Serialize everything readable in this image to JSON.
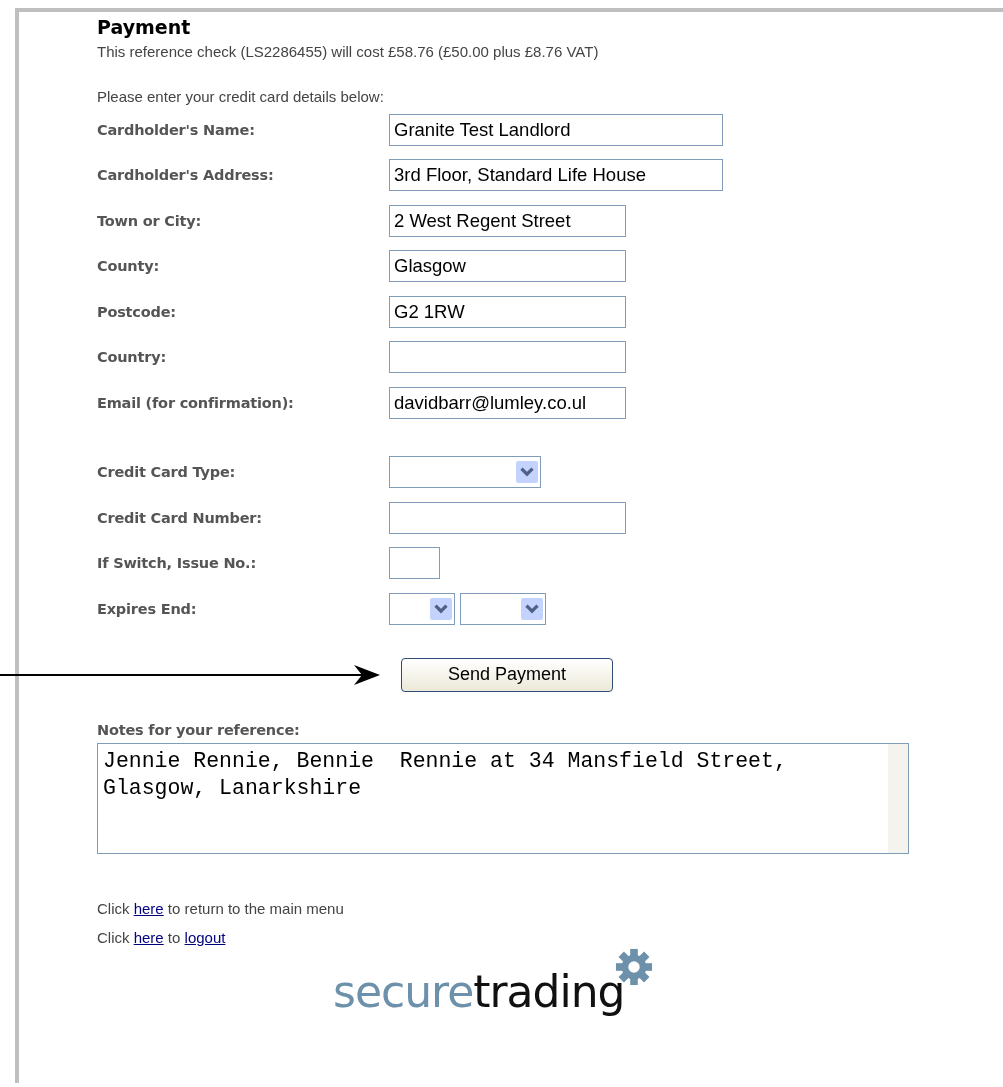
{
  "title": "Payment",
  "summary": "This reference check (LS2286455) will cost £58.76 (£50.00 plus £8.76 VAT)",
  "instruction": "Please enter your credit card details below:",
  "cardholder_fields": [
    {
      "label": "Cardholder's Name:",
      "kind": "text",
      "value": "Granite Test Landlord"
    },
    {
      "label": "Cardholder's Address:",
      "kind": "text",
      "value": "3rd Floor, Standard Life House"
    },
    {
      "label": "Town or City:",
      "kind": "text",
      "value": "2 West Regent Street"
    },
    {
      "label": "County:",
      "kind": "text",
      "value": "Glasgow"
    },
    {
      "label": "Postcode:",
      "kind": "text",
      "value": "G2 1RW"
    },
    {
      "label": "Country:",
      "kind": "text"
    },
    {
      "label": "Email (for confirmation):",
      "kind": "text",
      "value": "davidbarr@lumley.co.ul"
    }
  ],
  "card_fields": [
    {
      "label": "Credit Card Type:",
      "kind": "select"
    },
    {
      "label": "Credit Card Number:",
      "kind": "text"
    },
    {
      "label": "If Switch, Issue No.:",
      "kind": "text"
    },
    {
      "label": "Expires End:",
      "kind": "expiry"
    }
  ],
  "submit_button": "Send Payment",
  "notes": {
    "label": "Notes for your reference:",
    "value": "Jennie Rennie, Bennie  Rennie at 34 Mansfield Street, Glasgow, Lanarkshire"
  },
  "links": [
    {
      "parts": [
        {
          "text": "Click "
        },
        {
          "text": "here",
          "link": true
        },
        {
          "text": " to return to the main menu"
        }
      ]
    },
    {
      "parts": [
        {
          "text": "Click "
        },
        {
          "text": "here",
          "link": true
        },
        {
          "text": " to "
        },
        {
          "text": "logout",
          "link": true
        }
      ]
    }
  ],
  "logo": {
    "first": "secure",
    "second": "trading"
  }
}
